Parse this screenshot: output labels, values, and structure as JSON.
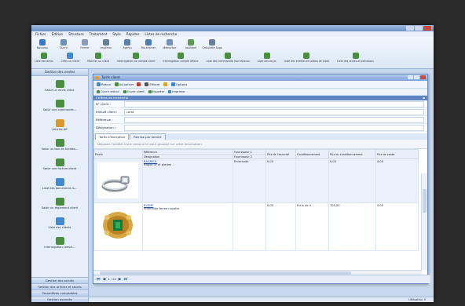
{
  "app": {
    "title": "",
    "menu": [
      "Fichier",
      "Édition",
      "Structure",
      "Traitement",
      "Style",
      "Rapides",
      "Listes de recherche"
    ]
  },
  "ribbon": {
    "row1": [
      {
        "label": "Nouveau",
        "icon": "new-icon",
        "color": "#3c78c8"
      },
      {
        "label": "Ouvrir",
        "icon": "open-icon",
        "color": "#6e8fb8"
      },
      {
        "label": "Fermer",
        "icon": "close-doc-icon",
        "color": "#8a9bb3"
      },
      {
        "label": "Imprimer",
        "icon": "print-icon",
        "color": "#6b7c95"
      },
      {
        "label": "Aperçu",
        "icon": "preview-icon",
        "color": "#5c7fb0"
      },
      {
        "label": "Rechercher",
        "icon": "search-icon",
        "color": "#4e77b3"
      },
      {
        "label": "Mémoriser",
        "icon": "memory-icon",
        "color": "#7790b4"
      },
      {
        "label": "Assistant",
        "icon": "wizard-icon",
        "color": "#5c9a52"
      },
      {
        "label": "Calculette Saga",
        "icon": "calculator-icon",
        "color": "#6c7d98"
      }
    ],
    "row2": [
      {
        "label": "Liste des devis",
        "color": "#4a8f3e"
      },
      {
        "label": "Créer un client",
        "color": "#3f8ad0"
      },
      {
        "label": "Marcher un client",
        "color": "#4a8f3e"
      },
      {
        "label": "Interrogation de compte client",
        "color": "#4a8f3e"
      },
      {
        "label": "Interrogation compte affaire",
        "color": "#4a8f3e"
      },
      {
        "label": "Liste des commandes fournisseurs",
        "color": "#4a8f3e"
      },
      {
        "label": "Liste des reçus",
        "color": "#4a8f3e"
      },
      {
        "label": "Liste des entrées et sorties de stock",
        "color": "#4a8f3e"
      },
      {
        "label": "Liste des ordres et prévisions",
        "color": "#4a8f3e"
      }
    ]
  },
  "sidebar": {
    "header": "Gestion des ventes",
    "items": [
      {
        "label": "Saisir un devis client",
        "icon": "quote-icon",
        "color": "#4a8f3e"
      },
      {
        "label": "Saisir une commande…",
        "icon": "order-icon",
        "color": "#4a8f3e"
      },
      {
        "label": "Articles.dff",
        "icon": "articles-icon",
        "color": "#d99a2b"
      },
      {
        "label": "Saisir un bon de livraiso…",
        "icon": "delivery-icon",
        "color": "#4a8f3e"
      },
      {
        "label": "Saisir une facture client",
        "icon": "invoice-icon",
        "color": "#4a8f3e"
      },
      {
        "label": "Liste des documents &…",
        "icon": "documents-icon",
        "color": "#3f8ad0"
      },
      {
        "label": "Saisir un règlement client",
        "icon": "payment-icon",
        "color": "#4a8f3e"
      },
      {
        "label": "Liste des clients",
        "icon": "clients-icon",
        "color": "#3f8ad0"
      },
      {
        "label": "Interrogation compt…",
        "icon": "query-icon",
        "color": "#4a8f3e"
      }
    ],
    "footer": [
      "Gestion des achats",
      "Gestion des articles et stocks",
      "Paramètres comptables",
      "Gestion avancée"
    ]
  },
  "window": {
    "title": "Tarifs client",
    "toolbar1": [
      {
        "label": "Retour",
        "color": "#3f8ad0"
      },
      {
        "label": "Actualiser",
        "color": "#4a8f3e"
      },
      {
        "label": "",
        "color": "#c33b2f"
      },
      {
        "label": "Effacer",
        "color": "#555"
      },
      {
        "label": "",
        "color": "#d9a52b"
      },
      {
        "label": "Options",
        "color": "#3f8ad0"
      }
    ],
    "toolbar2": [
      {
        "label": "Ouvrir article",
        "color": "#4a8f3e"
      },
      {
        "label": "Ouvrir client",
        "color": "#4a8f3e"
      },
      {
        "label": "Exporter",
        "color": "#4a8f3e"
      },
      {
        "label": "Imprimer",
        "color": "#3f8ad0"
      }
    ],
    "criteria_header": "Critères de recherche",
    "fields": [
      {
        "label": "N° client :",
        "value": ""
      },
      {
        "label": "Intitulé client :",
        "value": "carat"
      },
      {
        "label": "Référence :",
        "value": ""
      },
      {
        "label": "Désignation :",
        "value": ""
      }
    ],
    "tabs": [
      "Tarifs d'exception",
      "Remise par famille"
    ],
    "group_hint": "Déposez l'entête d'une colonne ici pour grouper sur cette information.",
    "columns": {
      "photo": "Photo",
      "ref": "Référence",
      "designation": "Désignation",
      "fourn1": "Fournisseur 1",
      "fourn2": "Fournisseur 2",
      "prix_unitaire": "Prix de l'accordé",
      "conditionnement": "Conditionnement",
      "prix_cond": "Prix du conditionnement",
      "prix_vente": "Prix de vente"
    },
    "rows": [
      {
        "ref": "BAGREOL",
        "designation": "Bague Or et pierres",
        "fournisseur": "Emeraude",
        "prix": "0,00",
        "conditionnement": "",
        "prix_cond": "0,00",
        "prix_vente": "0,00"
      },
      {
        "ref": "BVEME",
        "designation": "Emeraude forme navette",
        "fournisseur": "",
        "prix": "0,00",
        "conditionnement": "Ecrin de 4",
        "prix_cond": "700,00",
        "prix_vente": "0,00"
      }
    ],
    "pager": "1 / 20"
  },
  "status": {
    "text": "Utilisateur 0"
  }
}
